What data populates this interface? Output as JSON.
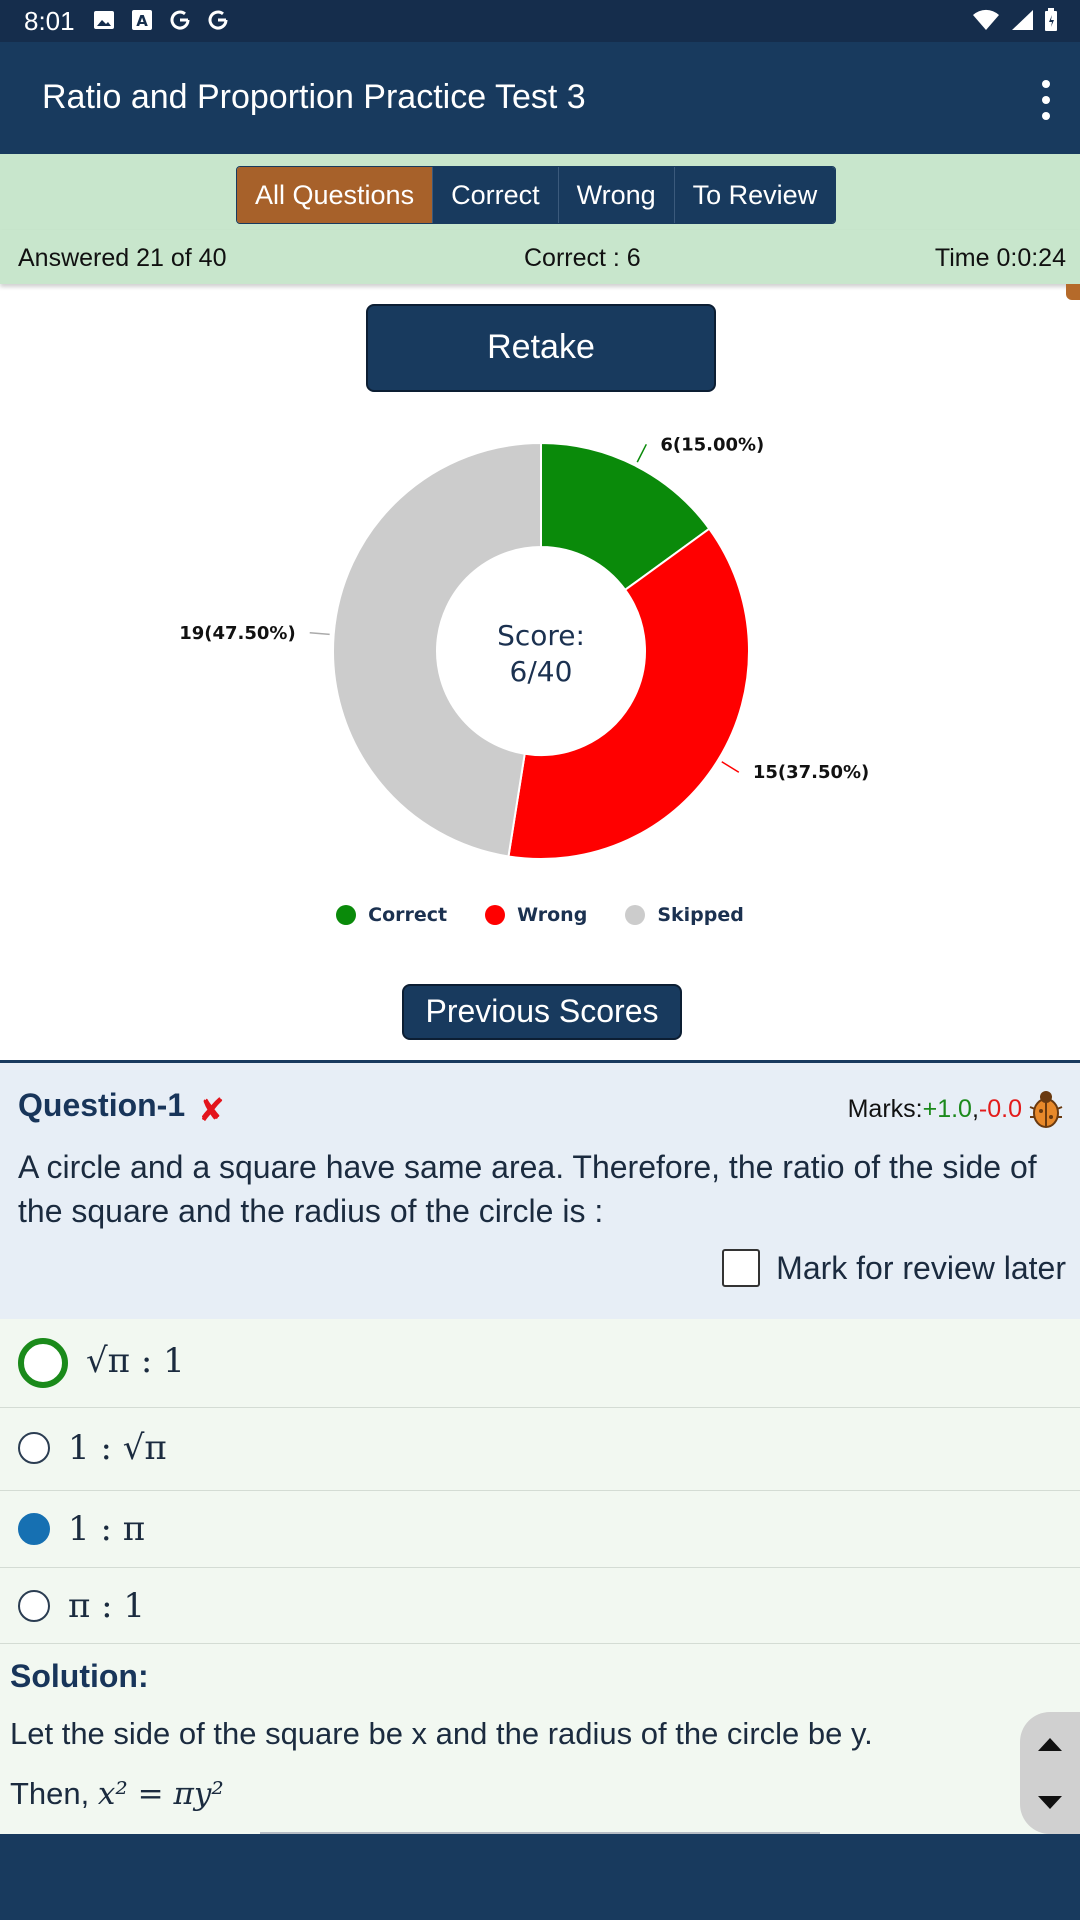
{
  "status_bar": {
    "time": "8:01",
    "icons": [
      "image-icon",
      "a-icon",
      "google-icon",
      "google-icon",
      "wifi-icon",
      "signal-icon",
      "battery-icon"
    ]
  },
  "app": {
    "title": "Ratio and Proportion Practice Test 3"
  },
  "tabs": [
    {
      "label": "All Questions",
      "active": true
    },
    {
      "label": "Correct",
      "active": false
    },
    {
      "label": "Wrong",
      "active": false
    },
    {
      "label": "To Review",
      "active": false
    }
  ],
  "stats": {
    "answered": "Answered 21 of 40",
    "correct": "Correct : 6",
    "time": "Time 0:0:24"
  },
  "retake_label": "Retake",
  "chart_data": {
    "type": "pie",
    "hole": true,
    "center_text": [
      "Score:",
      "6/40"
    ],
    "slices": [
      {
        "name": "Correct",
        "value": 6,
        "label": "6(15.00%)",
        "color": "#0a8a0a"
      },
      {
        "name": "Wrong",
        "value": 15,
        "label": "15(37.50%)",
        "color": "#ff0000"
      },
      {
        "name": "Skipped",
        "value": 19,
        "label": "19(47.50%)",
        "color": "#cccccc"
      }
    ],
    "legend_position": "bottom"
  },
  "previous_scores_label": "Previous Scores",
  "question": {
    "title": "Question-1",
    "marks_label": "Marks:",
    "marks_positive": "+1.0",
    "marks_sep": ",",
    "marks_negative": "-0.0",
    "text": "A circle and a square have same area. Therefore, the ratio of the side of the square and the radius of the circle is :",
    "review_label": "Mark for review later",
    "options": [
      {
        "text": "√π : 1",
        "state": "correct"
      },
      {
        "text": "1 : √π",
        "state": "none"
      },
      {
        "text": "1 : π",
        "state": "selected"
      },
      {
        "text": "π : 1",
        "state": "none"
      }
    ]
  },
  "solution": {
    "title": "Solution:",
    "line1": "Let the side of the square be x and the radius of the circle be y.",
    "line2_prefix": "Then, ",
    "line2_math": "x² = πy²"
  }
}
